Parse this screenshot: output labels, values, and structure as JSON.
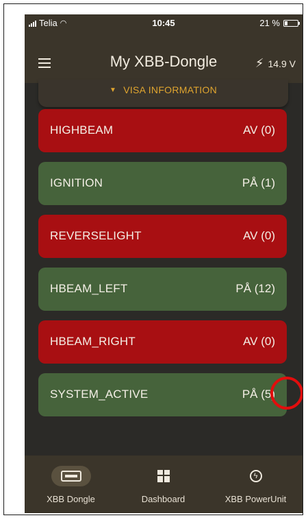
{
  "status_bar": {
    "carrier": "Telia",
    "time": "10:45",
    "battery": "21 %",
    "battery_level": 0.21
  },
  "header": {
    "title": "My XBB-Dongle",
    "voltage": "14.9 V"
  },
  "info_toggle": {
    "label": "VISA INFORMATION"
  },
  "signals": [
    {
      "name": "HIGHBEAM",
      "state": "AV (0)",
      "status": "off"
    },
    {
      "name": "IGNITION",
      "state": "PÅ (1)",
      "status": "on"
    },
    {
      "name": "REVERSELIGHT",
      "state": "AV (0)",
      "status": "off"
    },
    {
      "name": "HBEAM_LEFT",
      "state": "PÅ (12)",
      "status": "on"
    },
    {
      "name": "HBEAM_RIGHT",
      "state": "AV (0)",
      "status": "off"
    },
    {
      "name": "SYSTEM_ACTIVE",
      "state": "PÅ (5)",
      "status": "on"
    }
  ],
  "bottom_nav": [
    {
      "label": "XBB Dongle",
      "icon": "usb-dongle-icon",
      "active": true
    },
    {
      "label": "Dashboard",
      "icon": "dashboard-icon",
      "active": false
    },
    {
      "label": "XBB PowerUnit",
      "icon": "power-icon",
      "active": false
    }
  ],
  "colors": {
    "off": "#a80f12",
    "on": "#46633b",
    "accent": "#e0a52f",
    "background": "#2b2a27",
    "bar": "#3b352a",
    "annotation": "#e20d0d"
  }
}
